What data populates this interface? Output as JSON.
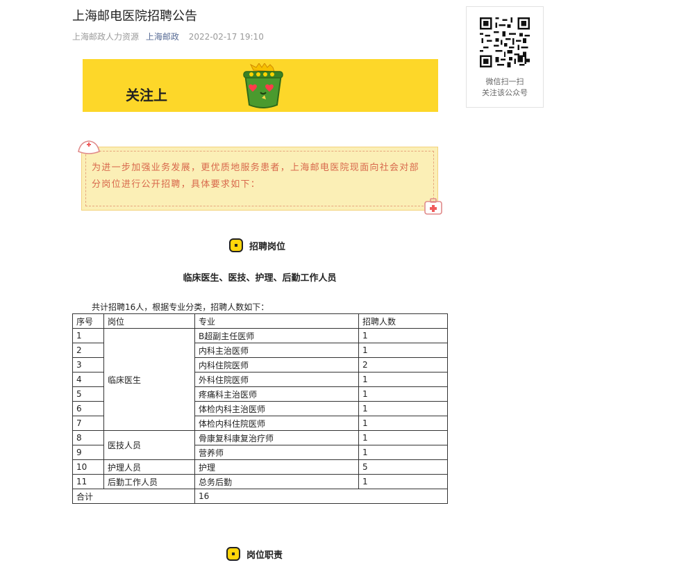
{
  "article": {
    "title": "上海邮电医院招聘公告",
    "meta": {
      "source": "上海邮政人力资源",
      "account": "上海邮政",
      "datetime": "2022-02-17 19:10"
    }
  },
  "banner": {
    "text": "关注上",
    "background_color": "#fdd729"
  },
  "intro": {
    "text": "为进一步加强业务发展，更优质地服务患者，上海邮电医院现面向社会对部分岗位进行公开招聘，具体要求如下：",
    "text_color": "#d8684c"
  },
  "sections": {
    "positions_heading": "招聘岗位",
    "duties_heading": "岗位职责"
  },
  "recruit": {
    "subtitle": "临床医生、医技、护理、后勤工作人员",
    "summary": "共计招聘16人，根据专业分类，招聘人数如下：",
    "table": {
      "headers": [
        "序号",
        "岗位",
        "专业",
        "招聘人数"
      ],
      "rows": [
        {
          "no": "1",
          "major": "B超副主任医师",
          "count": "1"
        },
        {
          "no": "2",
          "major": "内科主治医师",
          "count": "1"
        },
        {
          "no": "3",
          "major": "内科住院医师",
          "count": "2"
        },
        {
          "no": "4",
          "major": "外科住院医师",
          "count": "1"
        },
        {
          "no": "5",
          "major": "疼痛科主治医师",
          "count": "1"
        },
        {
          "no": "6",
          "major": "体检内科主治医师",
          "count": "1"
        },
        {
          "no": "7",
          "major": "体检内科住院医师",
          "count": "1"
        },
        {
          "no": "8",
          "major": "骨康复科康复治疗师",
          "count": "1"
        },
        {
          "no": "9",
          "major": "营养师",
          "count": "1"
        },
        {
          "no": "10",
          "major": "护理",
          "count": "5"
        },
        {
          "no": "11",
          "major": "总务后勤",
          "count": "1"
        }
      ],
      "posts": {
        "clinical": "临床医生",
        "medtech": "医技人员",
        "nursing": "护理人员",
        "logistics": "后勤工作人员"
      },
      "total_label": "合计",
      "total_value": "16"
    }
  },
  "qr_card": {
    "line1": "微信扫一扫",
    "line2": "关注该公众号"
  },
  "icons": {
    "section_badge": "square-badge-icon",
    "mascot": "green-bucket-mascot-icon",
    "nurse_cap": "nurse-cap-icon",
    "first_aid_kit": "first-aid-kit-icon",
    "accent_color": "#ffd60a"
  }
}
